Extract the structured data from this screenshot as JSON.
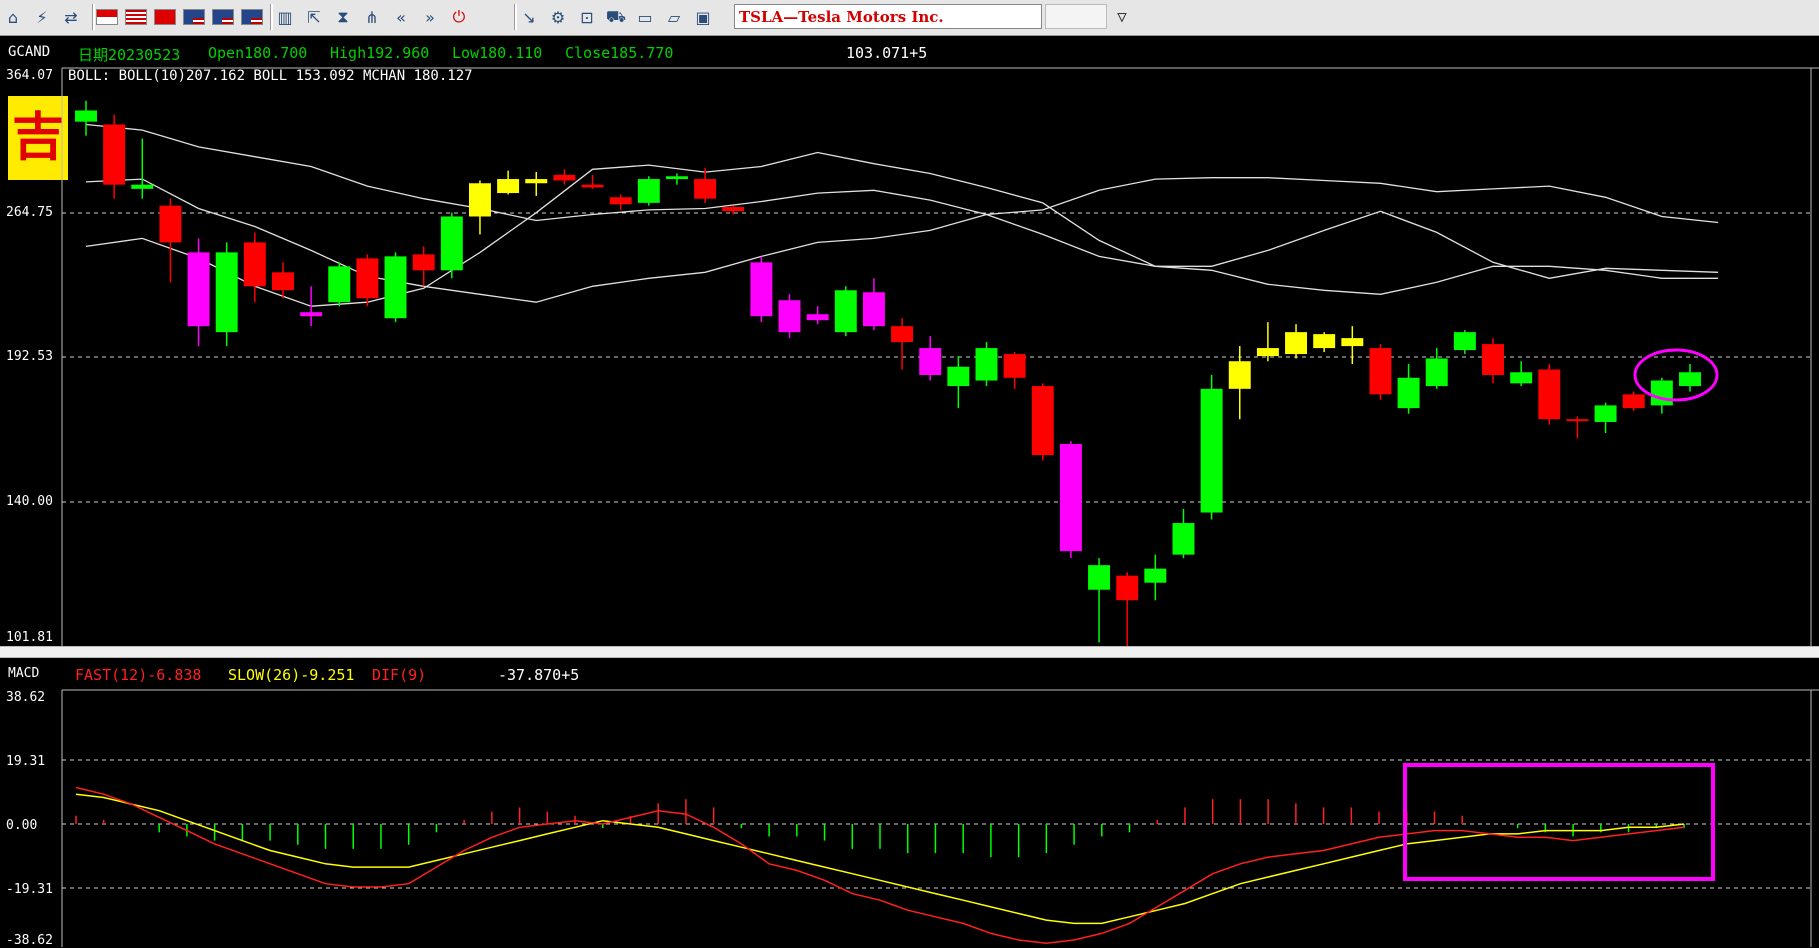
{
  "toolbar": {
    "symbol": "TSLA—Tesla Motors Inc.",
    "period_value": "",
    "groups": [
      [
        "home-icon",
        "signal-icon",
        "swap-icon"
      ],
      [
        "flag-icon",
        "flag-icon",
        "flag-icon",
        "flag-icon",
        "flag-icon",
        "flag-icon"
      ],
      [
        "bar-chart-icon",
        "export-icon",
        "hourglass-icon",
        "network-icon",
        "rewind-icon",
        "fast-forward-icon",
        "power-icon"
      ],
      [
        "chart-tool-icon",
        "gear-icon",
        "zoom-icon",
        "cart-icon",
        "folder-icon",
        "open-folder-icon",
        "monitor-icon"
      ]
    ]
  },
  "main_chart": {
    "code": "GCAND",
    "date_label": "日期20230523",
    "open_label": "Open180.700",
    "high_label": "High192.960",
    "low_label": "Low180.110",
    "close_label": "Close185.770",
    "cursor_value": "103.071+5",
    "top_axis_value": "364.07",
    "indicator_line": "BOLL: BOLL(10)207.162  BOLL 153.092  MCHAN 180.127",
    "badge_char": "吉",
    "y_ticks": [
      "264.75",
      "192.53",
      "140.00",
      "101.81"
    ]
  },
  "macd_chart": {
    "name": "MACD",
    "fast_label": "FAST(12)-6.838",
    "slow_label": "SLOW(26)-9.251",
    "dif_label": "DIF(9)",
    "cursor_value": "-37.870+5",
    "y_ticks": [
      "38.62",
      "19.31",
      "0.00",
      "-19.31",
      "-38.62"
    ]
  },
  "colors": {
    "up": "#00ff00",
    "down": "#ff0000",
    "yellow": "#ffff00",
    "magenta": "#ff00ff",
    "boll": "#e0e0e0",
    "fast": "#ff2020",
    "slow": "#ffff00"
  },
  "chart_data": [
    {
      "type": "candlestick",
      "title": "GCAND",
      "ylim": [
        101.81,
        364.07
      ],
      "ticks": [
        101.81,
        140.0,
        192.53,
        264.75,
        364.07
      ],
      "candles": [
        {
          "o": 330,
          "h": 345,
          "l": 320,
          "c": 338,
          "color": "up"
        },
        {
          "o": 328,
          "h": 335,
          "l": 275,
          "c": 285,
          "color": "down"
        },
        {
          "o": 282,
          "h": 318,
          "l": 275,
          "c": 285,
          "color": "up"
        },
        {
          "o": 270,
          "h": 275,
          "l": 230,
          "c": 250,
          "color": "down"
        },
        {
          "o": 245,
          "h": 252,
          "l": 198,
          "c": 208,
          "color": "magenta"
        },
        {
          "o": 205,
          "h": 250,
          "l": 198,
          "c": 245,
          "color": "up"
        },
        {
          "o": 250,
          "h": 255,
          "l": 220,
          "c": 228,
          "color": "down"
        },
        {
          "o": 235,
          "h": 240,
          "l": 222,
          "c": 226,
          "color": "down"
        },
        {
          "o": 215,
          "h": 228,
          "l": 208,
          "c": 213,
          "color": "magenta"
        },
        {
          "o": 220,
          "h": 240,
          "l": 218,
          "c": 238,
          "color": "up"
        },
        {
          "o": 242,
          "h": 244,
          "l": 218,
          "c": 222,
          "color": "down"
        },
        {
          "o": 212,
          "h": 245,
          "l": 210,
          "c": 243,
          "color": "up"
        },
        {
          "o": 244,
          "h": 248,
          "l": 228,
          "c": 236,
          "color": "down"
        },
        {
          "o": 236,
          "h": 265,
          "l": 232,
          "c": 263,
          "color": "up"
        },
        {
          "o": 263,
          "h": 288,
          "l": 254,
          "c": 286,
          "color": "yellow"
        },
        {
          "o": 279,
          "h": 295,
          "l": 278,
          "c": 289,
          "color": "yellow"
        },
        {
          "o": 286,
          "h": 294,
          "l": 277,
          "c": 289,
          "color": "yellow"
        },
        {
          "o": 292,
          "h": 296,
          "l": 285,
          "c": 288,
          "color": "down"
        },
        {
          "o": 283,
          "h": 292,
          "l": 282,
          "c": 285,
          "color": "down"
        },
        {
          "o": 276,
          "h": 278,
          "l": 267,
          "c": 271,
          "color": "down"
        },
        {
          "o": 272,
          "h": 291,
          "l": 270,
          "c": 289,
          "color": "up"
        },
        {
          "o": 289,
          "h": 293,
          "l": 285,
          "c": 291,
          "color": "up"
        },
        {
          "o": 289,
          "h": 297,
          "l": 272,
          "c": 275,
          "color": "down"
        },
        {
          "o": 269,
          "h": 270,
          "l": 264,
          "c": 266,
          "color": "down"
        },
        {
          "o": 240,
          "h": 243,
          "l": 210,
          "c": 213,
          "color": "magenta"
        },
        {
          "o": 221,
          "h": 224,
          "l": 202,
          "c": 205,
          "color": "magenta"
        },
        {
          "o": 214,
          "h": 218,
          "l": 209,
          "c": 211,
          "color": "magenta"
        },
        {
          "o": 205,
          "h": 228,
          "l": 203,
          "c": 226,
          "color": "up"
        },
        {
          "o": 225,
          "h": 232,
          "l": 206,
          "c": 208,
          "color": "magenta"
        },
        {
          "o": 208,
          "h": 212,
          "l": 188,
          "c": 200,
          "color": "down"
        },
        {
          "o": 197,
          "h": 203,
          "l": 184,
          "c": 186,
          "color": "magenta"
        },
        {
          "o": 182,
          "h": 193,
          "l": 174,
          "c": 189,
          "color": "up"
        },
        {
          "o": 184,
          "h": 200,
          "l": 182,
          "c": 197,
          "color": "up"
        },
        {
          "o": 194,
          "h": 195,
          "l": 181,
          "c": 185,
          "color": "down"
        },
        {
          "o": 182,
          "h": 183,
          "l": 155,
          "c": 157,
          "color": "down"
        },
        {
          "o": 161,
          "h": 162,
          "l": 124,
          "c": 126,
          "color": "magenta"
        },
        {
          "o": 115,
          "h": 124,
          "l": 100,
          "c": 122,
          "color": "up"
        },
        {
          "o": 119,
          "h": 120,
          "l": 98,
          "c": 112,
          "color": "down"
        },
        {
          "o": 117,
          "h": 125,
          "l": 112,
          "c": 121,
          "color": "up"
        },
        {
          "o": 125,
          "h": 138,
          "l": 124,
          "c": 134,
          "color": "up"
        },
        {
          "o": 137,
          "h": 186,
          "l": 135,
          "c": 181,
          "color": "up"
        },
        {
          "o": 181,
          "h": 198,
          "l": 170,
          "c": 191,
          "color": "yellow"
        },
        {
          "o": 193,
          "h": 210,
          "l": 191,
          "c": 197,
          "color": "yellow"
        },
        {
          "o": 194,
          "h": 209,
          "l": 192,
          "c": 205,
          "color": "yellow"
        },
        {
          "o": 197,
          "h": 205,
          "l": 195,
          "c": 204,
          "color": "yellow"
        },
        {
          "o": 198,
          "h": 208,
          "l": 190,
          "c": 202,
          "color": "yellow"
        },
        {
          "o": 197,
          "h": 199,
          "l": 177,
          "c": 179,
          "color": "down"
        },
        {
          "o": 174,
          "h": 190,
          "l": 172,
          "c": 185,
          "color": "up"
        },
        {
          "o": 182,
          "h": 197,
          "l": 181,
          "c": 192,
          "color": "up"
        },
        {
          "o": 196,
          "h": 206,
          "l": 194,
          "c": 205,
          "color": "up"
        },
        {
          "o": 199,
          "h": 202,
          "l": 183,
          "c": 186,
          "color": "down"
        },
        {
          "o": 183,
          "h": 191,
          "l": 182,
          "c": 187,
          "color": "up"
        },
        {
          "o": 188,
          "h": 190,
          "l": 168,
          "c": 170,
          "color": "down"
        },
        {
          "o": 170,
          "h": 171,
          "l": 163,
          "c": 170,
          "color": "down"
        },
        {
          "o": 169,
          "h": 176,
          "l": 165,
          "c": 175,
          "color": "up"
        },
        {
          "o": 179,
          "h": 180,
          "l": 173,
          "c": 174,
          "color": "down"
        },
        {
          "o": 175,
          "h": 185,
          "l": 172,
          "c": 184,
          "color": "up"
        },
        {
          "o": 182,
          "h": 190,
          "l": 180,
          "c": 187,
          "color": "up"
        }
      ],
      "boll_upper": [
        [
          0,
          248
        ],
        [
          2,
          252
        ],
        [
          4,
          242
        ],
        [
          6,
          228
        ],
        [
          8,
          218
        ],
        [
          10,
          220
        ],
        [
          12,
          227
        ],
        [
          14,
          245
        ],
        [
          16,
          265
        ],
        [
          18,
          296
        ],
        [
          20,
          299
        ],
        [
          22,
          294
        ],
        [
          24,
          298
        ],
        [
          26,
          308
        ],
        [
          28,
          300
        ],
        [
          30,
          293
        ],
        [
          32,
          283
        ],
        [
          34,
          272
        ],
        [
          36,
          251
        ],
        [
          38,
          238
        ],
        [
          40,
          236
        ],
        [
          42,
          229
        ],
        [
          44,
          226
        ],
        [
          46,
          224
        ],
        [
          48,
          230
        ],
        [
          50,
          238
        ],
        [
          52,
          238
        ],
        [
          54,
          236
        ],
        [
          56,
          232
        ],
        [
          58,
          232
        ]
      ],
      "boll_lower": [
        [
          0,
          328
        ],
        [
          2,
          324
        ],
        [
          4,
          312
        ],
        [
          6,
          305
        ],
        [
          8,
          298
        ],
        [
          10,
          284
        ],
        [
          12,
          275
        ],
        [
          14,
          268
        ],
        [
          16,
          261
        ],
        [
          18,
          264
        ],
        [
          20,
          267
        ],
        [
          22,
          268
        ],
        [
          24,
          273
        ],
        [
          26,
          279
        ],
        [
          28,
          281
        ],
        [
          30,
          274
        ],
        [
          32,
          264
        ],
        [
          34,
          254
        ],
        [
          36,
          243
        ],
        [
          38,
          238
        ],
        [
          40,
          238
        ],
        [
          42,
          246
        ],
        [
          44,
          256
        ],
        [
          46,
          266
        ],
        [
          48,
          255
        ],
        [
          50,
          240
        ],
        [
          52,
          232
        ],
        [
          54,
          237
        ],
        [
          56,
          236
        ],
        [
          58,
          235
        ]
      ],
      "mchan": [
        [
          0,
          287
        ],
        [
          2,
          289
        ],
        [
          4,
          268
        ],
        [
          6,
          258
        ],
        [
          8,
          246
        ],
        [
          10,
          233
        ],
        [
          12,
          228
        ],
        [
          14,
          224
        ],
        [
          16,
          220
        ],
        [
          18,
          228
        ],
        [
          20,
          232
        ],
        [
          22,
          235
        ],
        [
          24,
          243
        ],
        [
          26,
          250
        ],
        [
          28,
          252
        ],
        [
          30,
          256
        ],
        [
          32,
          264
        ],
        [
          34,
          267
        ],
        [
          36,
          281
        ],
        [
          38,
          289
        ],
        [
          40,
          290
        ],
        [
          42,
          290
        ],
        [
          44,
          288
        ],
        [
          46,
          286
        ],
        [
          48,
          280
        ],
        [
          50,
          282
        ],
        [
          52,
          284
        ],
        [
          54,
          276
        ],
        [
          56,
          263
        ],
        [
          58,
          260
        ]
      ],
      "highlight_circle_around_last_candle": true
    },
    {
      "type": "line",
      "title": "MACD",
      "ylim": [
        -38.62,
        38.62
      ],
      "ticks": [
        38.62,
        19.31,
        0.0,
        -19.31,
        -38.62
      ],
      "series": [
        {
          "name": "FAST(12)",
          "color": "red",
          "values": [
            11,
            9,
            6,
            2,
            -2,
            -6,
            -9,
            -12,
            -15,
            -18,
            -19,
            -19,
            -18,
            -13,
            -8,
            -4,
            -1,
            0,
            1,
            0,
            2,
            4,
            3,
            -1,
            -6,
            -12,
            -14,
            -17,
            -21,
            -23,
            -26,
            -28,
            -30,
            -33,
            -35,
            -36,
            -35,
            -33,
            -30,
            -25,
            -20,
            -15,
            -12,
            -10,
            -9,
            -8,
            -6,
            -4,
            -3,
            -2,
            -2,
            -3,
            -4,
            -4,
            -5,
            -4,
            -3,
            -2,
            -1
          ]
        },
        {
          "name": "SLOW(26)",
          "color": "yellow",
          "values": [
            9,
            8,
            6,
            4,
            1,
            -2,
            -5,
            -8,
            -10,
            -12,
            -13,
            -13,
            -13,
            -11,
            -9,
            -7,
            -5,
            -3,
            -1,
            1,
            0,
            -1,
            -3,
            -5,
            -7,
            -9,
            -11,
            -13,
            -15,
            -17,
            -19,
            -21,
            -23,
            -25,
            -27,
            -29,
            -30,
            -30,
            -28,
            -26,
            -24,
            -21,
            -18,
            -16,
            -14,
            -12,
            -10,
            -8,
            -6,
            -5,
            -4,
            -3,
            -3,
            -2,
            -2,
            -2,
            -1,
            -1,
            0
          ]
        },
        {
          "name": "DIF(9)",
          "type": "histogram",
          "values": [
            2,
            1,
            0,
            -2,
            -3,
            -4,
            -4,
            -4,
            -5,
            -6,
            -6,
            -6,
            -5,
            -2,
            1,
            3,
            4,
            3,
            2,
            -1,
            2,
            5,
            6,
            4,
            -1,
            -3,
            -3,
            -4,
            -6,
            -6,
            -7,
            -7,
            -7,
            -8,
            -8,
            -7,
            -5,
            -3,
            -2,
            1,
            4,
            6,
            6,
            6,
            5,
            4,
            4,
            3,
            3,
            3,
            2,
            0,
            -1,
            -2,
            -3,
            -2,
            -2,
            -1,
            -1
          ]
        }
      ]
    }
  ]
}
